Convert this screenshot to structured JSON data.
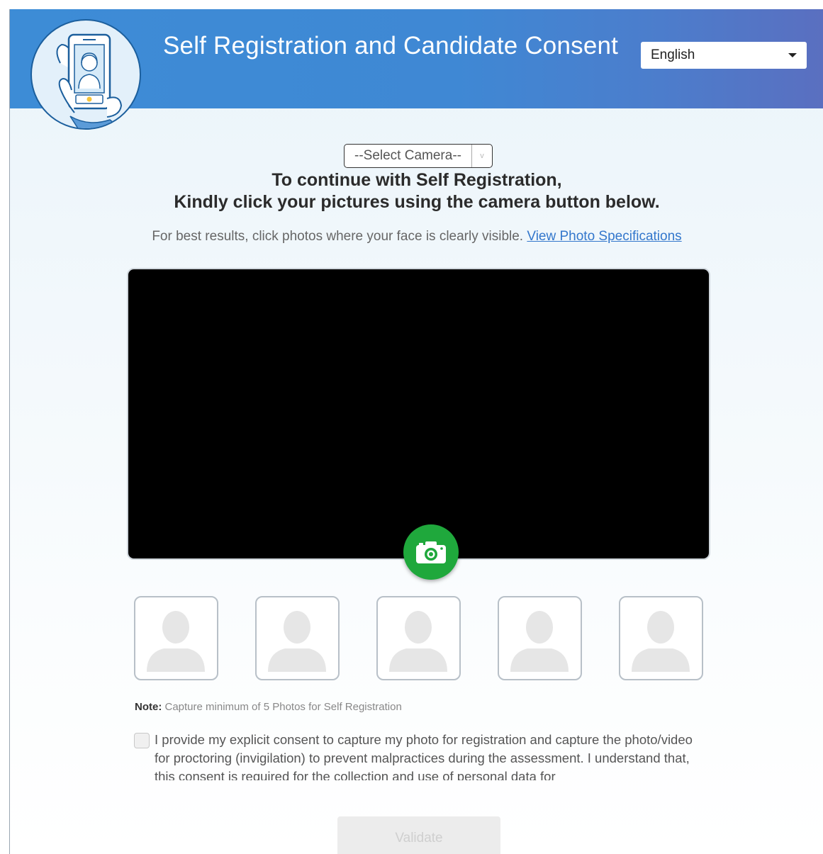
{
  "header": {
    "title": "Self Registration and Candidate Consent",
    "language": {
      "selected": "English"
    },
    "logo_icon": "selfie-phone-icon"
  },
  "camera": {
    "select_label": "--Select Camera--",
    "select_arrow": "v",
    "capture_icon": "camera-icon"
  },
  "instructions": {
    "line1": "To continue with Self Registration,",
    "line2": "Kindly click your pictures using the camera button below.",
    "hint": "For best results, click photos where your face is clearly visible.",
    "spec_link": "View Photo Specifications"
  },
  "thumbnails": [
    {
      "icon": "person-placeholder-icon"
    },
    {
      "icon": "person-placeholder-icon"
    },
    {
      "icon": "person-placeholder-icon"
    },
    {
      "icon": "person-placeholder-icon"
    },
    {
      "icon": "person-placeholder-icon"
    }
  ],
  "note": {
    "label": "Note:",
    "text": "Capture minimum of 5 Photos for Self Registration"
  },
  "consent": {
    "checked": false,
    "text": "I provide my explicit consent to capture my photo for registration and capture the photo/video for proctoring (invigilation) to prevent malpractices during the assessment. I understand that, this consent is required for the collection and use of personal data for"
  },
  "validate_label": "Validate",
  "colors": {
    "header_blue": "#3d8cd6",
    "capture_green": "#1fa83c",
    "link_blue": "#3377cc"
  }
}
